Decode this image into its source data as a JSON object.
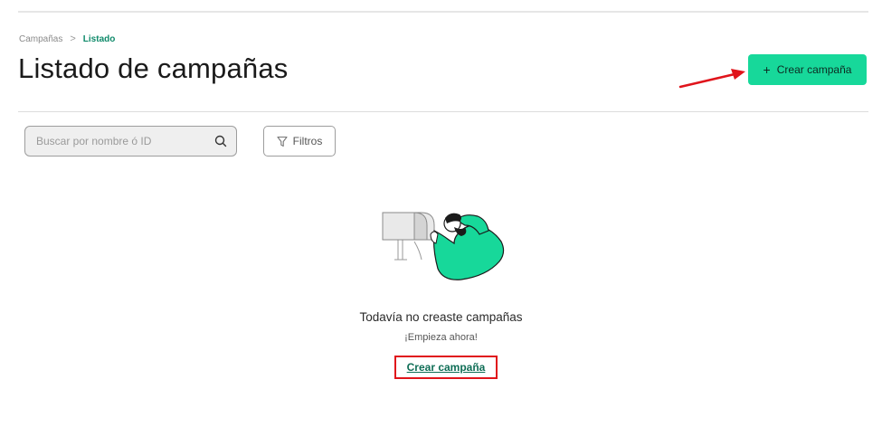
{
  "breadcrumb": {
    "root": "Campañas",
    "separator": ">",
    "current": "Listado"
  },
  "header": {
    "title": "Listado de campañas",
    "create_button": {
      "icon": "plus-icon",
      "label": "Crear campaña"
    }
  },
  "toolbar": {
    "search_placeholder": "Buscar por nombre ó ID",
    "search_icon": "search-icon",
    "filters_icon": "funnel-icon",
    "filters_label": "Filtros"
  },
  "empty_state": {
    "illustration": "person-with-mailbox-illustration",
    "title": "Todavía no creaste campañas",
    "subtitle": "¡Empieza ahora!",
    "link_label": "Crear campaña"
  },
  "colors": {
    "accent": "#17d89a",
    "link": "#0f6e56",
    "annotation": "#e0141b"
  }
}
